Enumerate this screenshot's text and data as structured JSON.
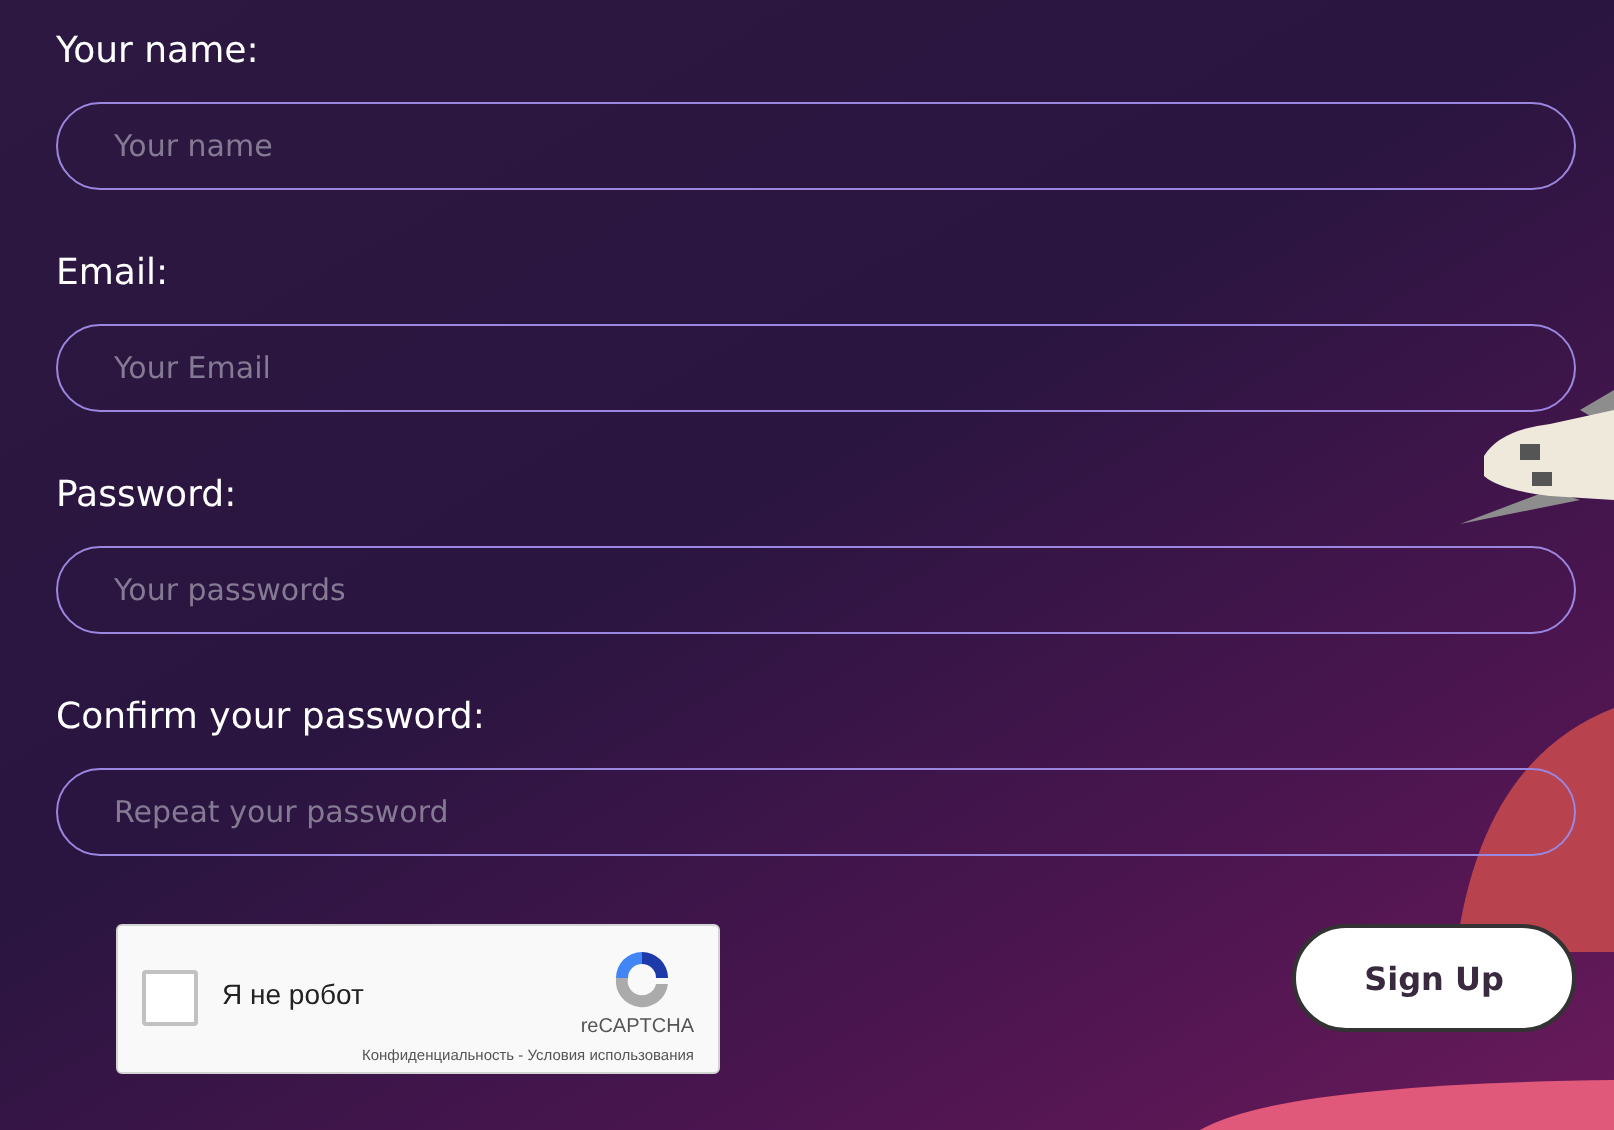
{
  "fields": [
    {
      "label": "Your name:",
      "placeholder": "Your name"
    },
    {
      "label": "Email:",
      "placeholder": "Your Email"
    },
    {
      "label": "Password:",
      "placeholder": "Your passwords"
    },
    {
      "label": "Confirm your password:",
      "placeholder": "Repeat your password"
    }
  ],
  "captcha": {
    "checked": false,
    "label": "Я не робот",
    "brand": "reCAPTCHA",
    "links": "Конфиденциальность - Условия использования"
  },
  "submit": {
    "label": "Sign Up"
  }
}
